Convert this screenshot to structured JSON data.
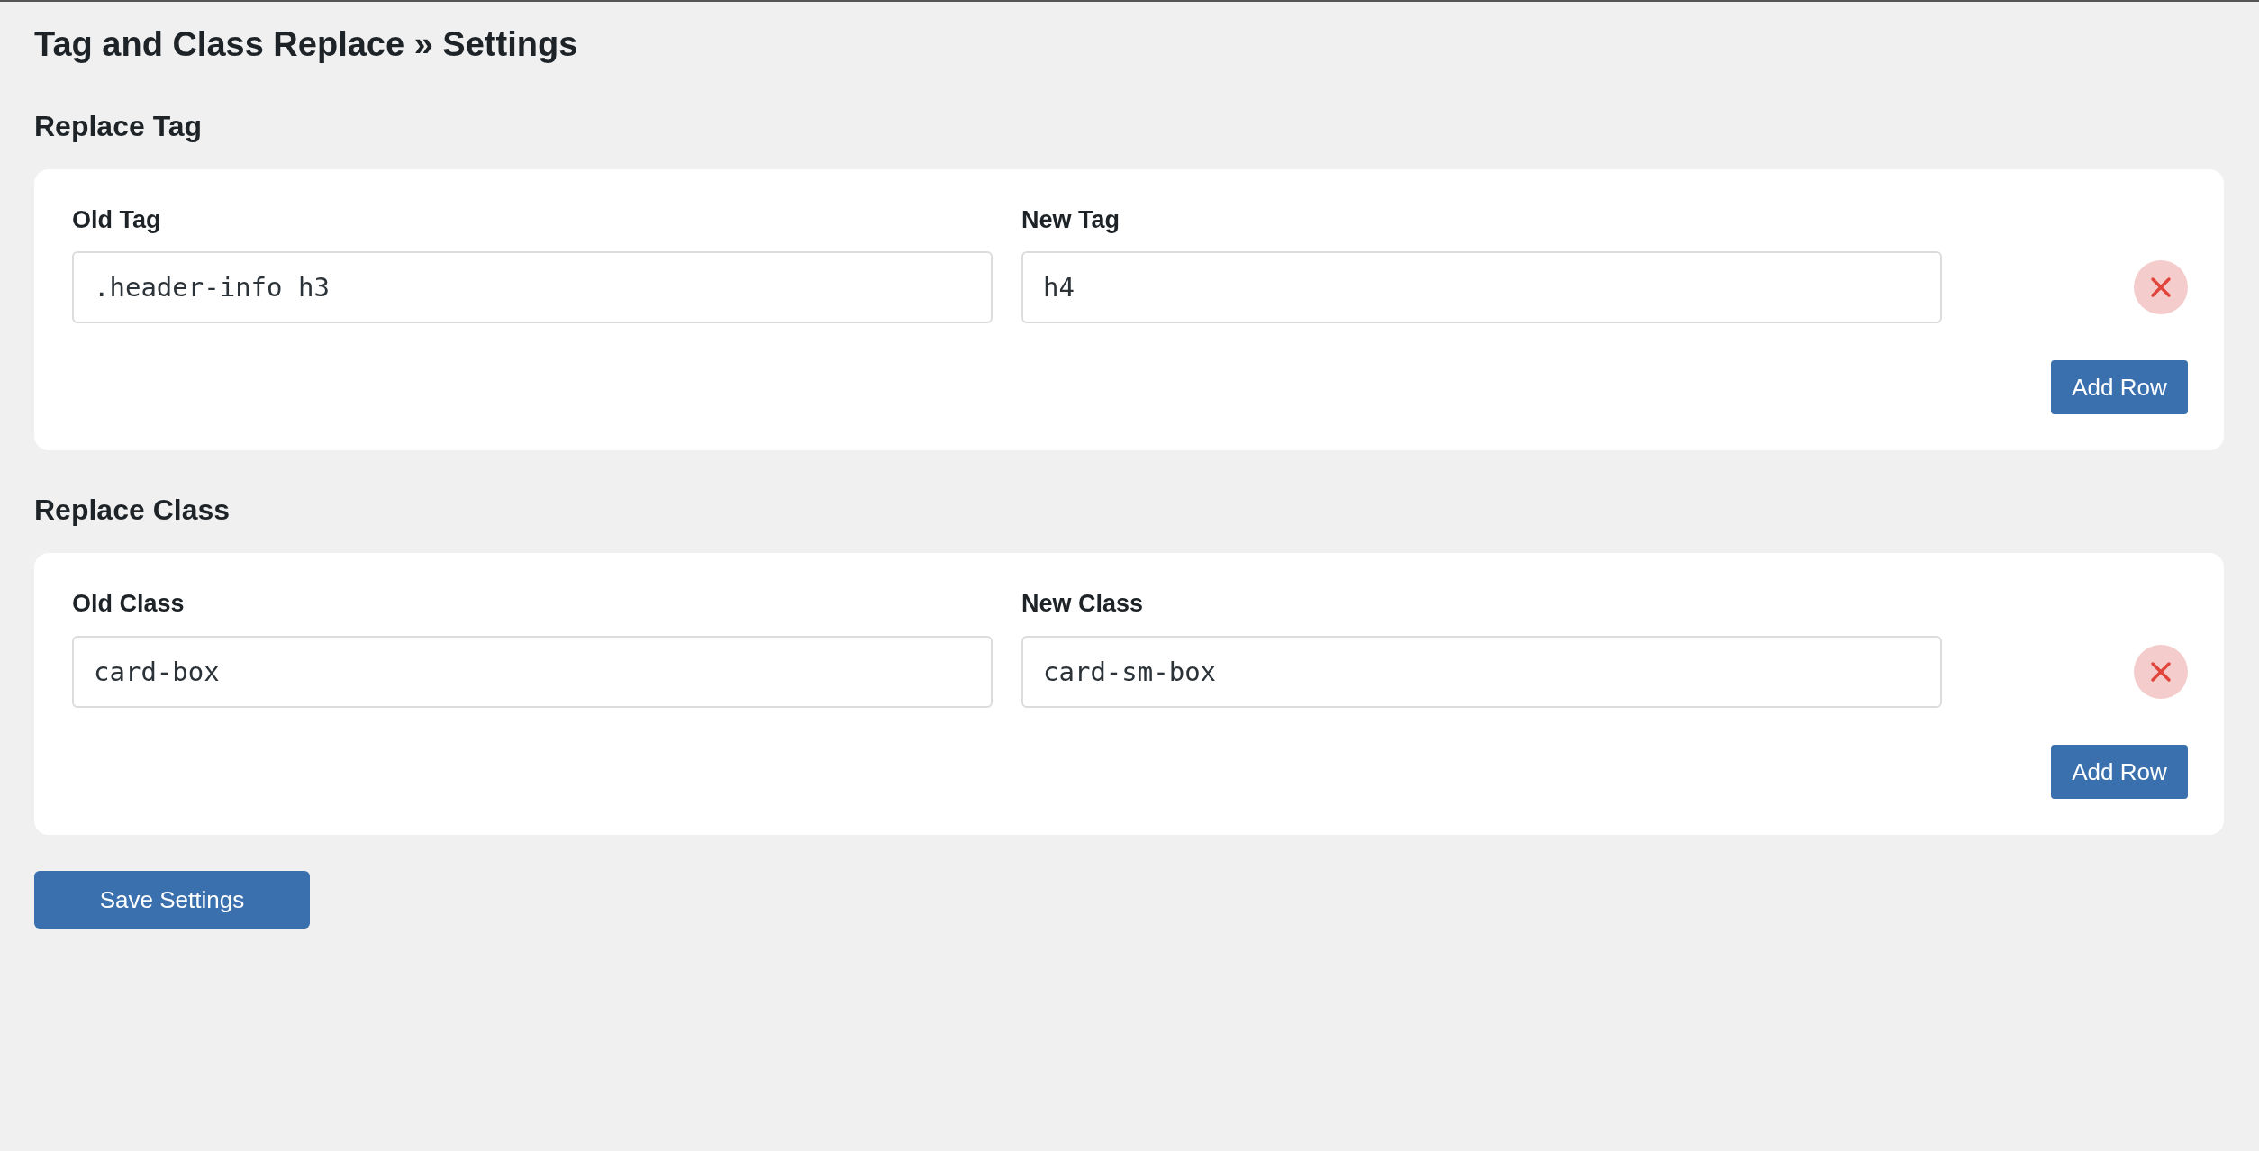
{
  "page_title": "Tag and Class Replace » Settings",
  "sections": [
    {
      "heading": "Replace Tag",
      "old_label": "Old Tag",
      "new_label": "New Tag",
      "rows": [
        {
          "old_value": ".header-info h3",
          "new_value": "h4"
        }
      ],
      "add_button": "Add Row"
    },
    {
      "heading": "Replace Class",
      "old_label": "Old Class",
      "new_label": "New Class",
      "rows": [
        {
          "old_value": "card-box",
          "new_value": "card-sm-box"
        }
      ],
      "add_button": "Add Row"
    }
  ],
  "save_button": "Save Settings"
}
